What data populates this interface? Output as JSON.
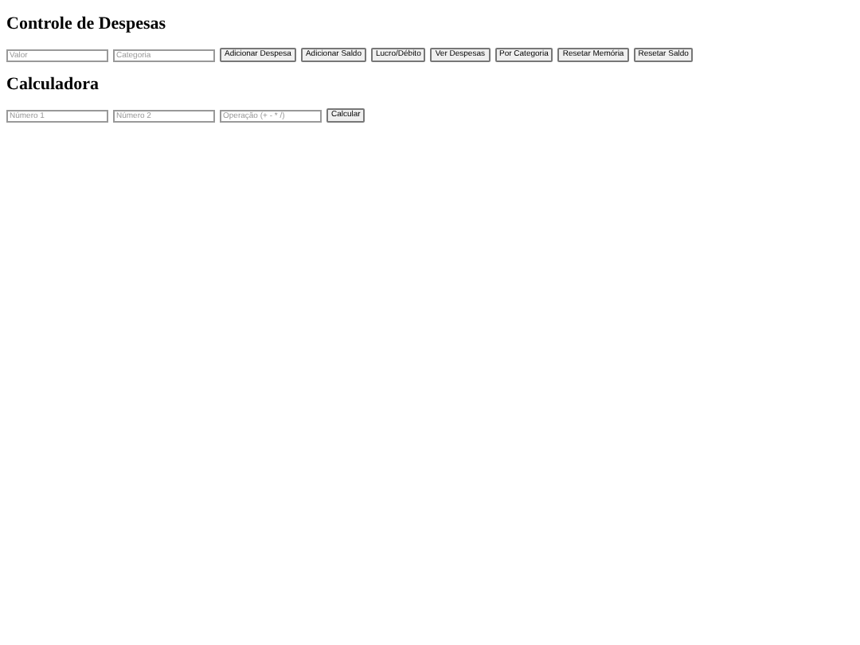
{
  "sections": [
    {
      "title": "Controle de Despesas",
      "fields": [
        {
          "placeholder": "Valor"
        },
        {
          "placeholder": "Categoria"
        }
      ],
      "buttons": [
        "Adicionar Despesa",
        "Adicionar Saldo",
        "Lucro/Débito",
        "Ver Despesas",
        "Por Categoria",
        "Resetar Memória",
        "Resetar Saldo"
      ]
    },
    {
      "title": "Calculadora",
      "fields": [
        {
          "placeholder": "Número 1"
        },
        {
          "placeholder": "Número 2"
        },
        {
          "placeholder": "Operação (+ - * /)"
        }
      ],
      "buttons": [
        "Calcular"
      ]
    }
  ]
}
